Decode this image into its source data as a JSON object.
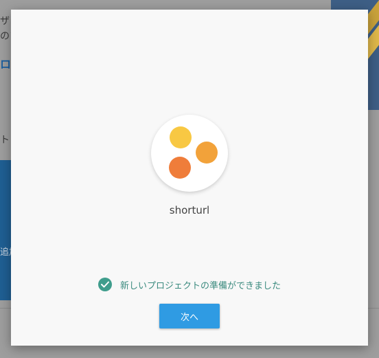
{
  "background": {
    "line1": "ザ",
    "line2": "のソ",
    "link": "ロ",
    "label": "ト",
    "blue_text": "追加"
  },
  "dialog": {
    "project_name": "shorturl",
    "status_text": "新しいプロジェクトの準備ができました",
    "next_label": "次へ",
    "logo": {
      "icon": "project-logo-dots",
      "dot_colors": [
        "#f8c843",
        "#f2a23a",
        "#ef7d3a"
      ]
    },
    "status_icon": "check-circle-icon"
  },
  "colors": {
    "accent": "#2f9be3",
    "success": "#3f9d8c",
    "dialog_bg": "#f8f8f8"
  }
}
